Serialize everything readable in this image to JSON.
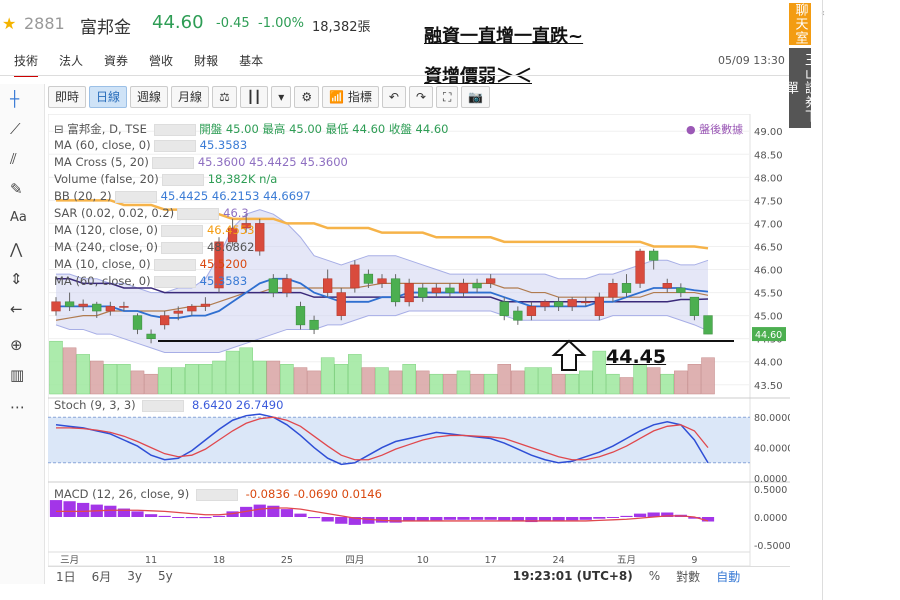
{
  "header": {
    "code": "2881",
    "name": "富邦金",
    "price": "44.60",
    "change": "-0.45",
    "change_pct": "-1.00%",
    "volume": "18,382張"
  },
  "annotation": {
    "line1": "融資一直增一直跌~",
    "line2": "資增價弱＞＜",
    "support_label": "44.45"
  },
  "nav": {
    "tabs": [
      "技術",
      "法人",
      "資券",
      "營收",
      "財報",
      "基本"
    ],
    "datetime": "05/09 13:30"
  },
  "side_tabs": {
    "tab1": "聊天室",
    "tab2": "玉山證券下單"
  },
  "toolbar": {
    "buttons": [
      "即時",
      "日線",
      "週線",
      "月線"
    ],
    "indicator_label": "指標"
  },
  "legend": {
    "symbol": "富邦金, D, TSE",
    "ohlc": "開盤 45.00 最高 45.00 最低 44.60 收盤 44.60",
    "after_hours": "盤後數據",
    "rows": [
      {
        "label": "MA (60, close, 0)",
        "values": "45.3583"
      },
      {
        "label": "MA Cross (5, 20)",
        "values": "45.3600  45.4425  45.3600"
      },
      {
        "label": "Volume (false, 20)",
        "values": "18,382K  n/a"
      },
      {
        "label": "BB (20, 2)",
        "values": "45.4425  46.2153  44.6697"
      },
      {
        "label": "SAR (0.02, 0.02, 0.2)",
        "values": "46.3"
      },
      {
        "label": "MA (120, close, 0)",
        "values": "46.4553"
      },
      {
        "label": "MA (240, close, 0)",
        "values": "48.6862"
      },
      {
        "label": "MA (10, close, 0)",
        "values": "45.5200"
      },
      {
        "label": "MA (60, close, 0)",
        "values": "45.3583"
      }
    ],
    "stoch": {
      "label": "Stoch (9, 3, 3)",
      "values": "8.6420  26.7490"
    },
    "macd": {
      "label": "MACD (12, 26, close, 9)",
      "values": "-0.0836  -0.0690  0.0146"
    }
  },
  "bottom": {
    "ranges": [
      "1日",
      "6月",
      "3y",
      "5y"
    ],
    "time": "19:23:01 (UTC+8)",
    "pct": "%",
    "log": "對數",
    "auto": "自動"
  },
  "chart_data": {
    "type": "candlestick",
    "price_axis_ticks": [
      "49.00",
      "48.50",
      "48.00",
      "47.50",
      "47.00",
      "46.50",
      "46.00",
      "45.50",
      "45.00",
      "44.50",
      "44.00",
      "43.50"
    ],
    "price_tag": "44.60",
    "x_tick_labels": [
      "三月",
      "11",
      "18",
      "25",
      "四月",
      "10",
      "17",
      "24",
      "五月",
      "9"
    ],
    "stoch_ticks": [
      "80.0000",
      "40.0000",
      "0.0000"
    ],
    "macd_ticks": [
      "0.5000",
      "0.0000",
      "-0.5000"
    ],
    "support_level": 44.45,
    "ylim": [
      43.3,
      49.2
    ],
    "candles": [
      {
        "o": 45.1,
        "c": 45.3,
        "h": 45.4,
        "l": 45.0
      },
      {
        "o": 45.3,
        "c": 45.2,
        "h": 45.5,
        "l": 45.1
      },
      {
        "o": 45.2,
        "c": 45.25,
        "h": 45.35,
        "l": 45.1
      },
      {
        "o": 45.25,
        "c": 45.1,
        "h": 45.3,
        "l": 44.95
      },
      {
        "o": 45.1,
        "c": 45.2,
        "h": 45.3,
        "l": 45.0
      },
      {
        "o": 45.2,
        "c": 45.2,
        "h": 45.3,
        "l": 45.1
      },
      {
        "o": 45.0,
        "c": 44.7,
        "h": 45.05,
        "l": 44.6
      },
      {
        "o": 44.6,
        "c": 44.5,
        "h": 44.7,
        "l": 44.4
      },
      {
        "o": 44.8,
        "c": 45.0,
        "h": 45.1,
        "l": 44.7
      },
      {
        "o": 45.05,
        "c": 45.1,
        "h": 45.2,
        "l": 44.9
      },
      {
        "o": 45.1,
        "c": 45.2,
        "h": 45.25,
        "l": 45.0
      },
      {
        "o": 45.2,
        "c": 45.25,
        "h": 45.4,
        "l": 45.1
      },
      {
        "o": 45.6,
        "c": 46.6,
        "h": 46.7,
        "l": 45.5
      },
      {
        "o": 46.6,
        "c": 46.9,
        "h": 47.1,
        "l": 46.5
      },
      {
        "o": 46.9,
        "c": 47.0,
        "h": 47.2,
        "l": 46.8
      },
      {
        "o": 46.4,
        "c": 47.0,
        "h": 47.1,
        "l": 46.3
      },
      {
        "o": 45.8,
        "c": 45.5,
        "h": 45.9,
        "l": 45.4
      },
      {
        "o": 45.5,
        "c": 45.8,
        "h": 45.9,
        "l": 45.4
      },
      {
        "o": 45.2,
        "c": 44.8,
        "h": 45.3,
        "l": 44.7
      },
      {
        "o": 44.9,
        "c": 44.7,
        "h": 45.0,
        "l": 44.6
      },
      {
        "o": 45.5,
        "c": 45.8,
        "h": 46.0,
        "l": 45.4
      },
      {
        "o": 45.0,
        "c": 45.5,
        "h": 45.6,
        "l": 44.9
      },
      {
        "o": 45.6,
        "c": 46.1,
        "h": 46.2,
        "l": 45.5
      },
      {
        "o": 45.9,
        "c": 45.7,
        "h": 46.0,
        "l": 45.6
      },
      {
        "o": 45.7,
        "c": 45.8,
        "h": 45.9,
        "l": 45.6
      },
      {
        "o": 45.8,
        "c": 45.3,
        "h": 45.9,
        "l": 45.2
      },
      {
        "o": 45.3,
        "c": 45.7,
        "h": 45.8,
        "l": 45.2
      },
      {
        "o": 45.6,
        "c": 45.4,
        "h": 45.7,
        "l": 45.3
      },
      {
        "o": 45.5,
        "c": 45.6,
        "h": 45.7,
        "l": 45.4
      },
      {
        "o": 45.6,
        "c": 45.5,
        "h": 45.7,
        "l": 45.4
      },
      {
        "o": 45.5,
        "c": 45.7,
        "h": 45.8,
        "l": 45.4
      },
      {
        "o": 45.7,
        "c": 45.6,
        "h": 45.8,
        "l": 45.5
      },
      {
        "o": 45.7,
        "c": 45.8,
        "h": 45.9,
        "l": 45.6
      },
      {
        "o": 45.3,
        "c": 45.0,
        "h": 45.4,
        "l": 44.9
      },
      {
        "o": 45.1,
        "c": 44.9,
        "h": 45.2,
        "l": 44.8
      },
      {
        "o": 45.0,
        "c": 45.2,
        "h": 45.3,
        "l": 44.9
      },
      {
        "o": 45.2,
        "c": 45.3,
        "h": 45.35,
        "l": 45.1
      },
      {
        "o": 45.3,
        "c": 45.2,
        "h": 45.4,
        "l": 45.1
      },
      {
        "o": 45.2,
        "c": 45.35,
        "h": 45.4,
        "l": 45.1
      },
      {
        "o": 45.3,
        "c": 45.3,
        "h": 45.4,
        "l": 45.2
      },
      {
        "o": 45.0,
        "c": 45.4,
        "h": 45.5,
        "l": 44.9
      },
      {
        "o": 45.4,
        "c": 45.7,
        "h": 45.8,
        "l": 45.3
      },
      {
        "o": 45.7,
        "c": 45.5,
        "h": 45.9,
        "l": 45.4
      },
      {
        "o": 45.7,
        "c": 46.4,
        "h": 46.45,
        "l": 45.6
      },
      {
        "o": 46.4,
        "c": 46.2,
        "h": 46.45,
        "l": 46.0
      },
      {
        "o": 45.6,
        "c": 45.7,
        "h": 45.8,
        "l": 45.5
      },
      {
        "o": 45.6,
        "c": 45.5,
        "h": 45.7,
        "l": 45.4
      },
      {
        "o": 45.4,
        "c": 45.0,
        "h": 45.4,
        "l": 44.9
      },
      {
        "o": 45.0,
        "c": 44.6,
        "h": 45.0,
        "l": 44.6
      }
    ],
    "volume": [
      16,
      14,
      12,
      10,
      9,
      9,
      7,
      6,
      8,
      8,
      9,
      9,
      10,
      13,
      14,
      10,
      10,
      9,
      8,
      7,
      11,
      9,
      12,
      8,
      8,
      7,
      9,
      7,
      6,
      6,
      7,
      6,
      6,
      9,
      7,
      8,
      8,
      6,
      6,
      7,
      13,
      6,
      5,
      9,
      8,
      6,
      7,
      9,
      11
    ],
    "bollinger": {
      "upper": [
        45.9,
        45.9,
        45.8,
        45.8,
        45.7,
        45.7,
        45.6,
        45.5,
        45.5,
        45.6,
        45.6,
        45.8,
        46.3,
        46.9,
        47.2,
        47.3,
        47.2,
        47.0,
        46.7,
        46.3,
        46.2,
        46.1,
        46.2,
        46.3,
        46.3,
        46.3,
        46.2,
        46.1,
        46.0,
        45.9,
        45.9,
        45.9,
        45.9,
        45.9,
        45.9,
        45.9,
        45.9,
        45.8,
        45.8,
        45.8,
        45.9,
        45.9,
        46.0,
        46.1,
        46.2,
        46.2,
        46.1,
        46.1,
        46.2
      ],
      "lower": [
        44.8,
        44.7,
        44.7,
        44.6,
        44.6,
        44.5,
        44.4,
        44.3,
        44.2,
        44.2,
        44.2,
        44.2,
        44.2,
        44.3,
        44.4,
        44.5,
        44.6,
        44.7,
        44.7,
        44.7,
        44.8,
        44.8,
        44.9,
        45.0,
        45.0,
        45.0,
        45.1,
        45.1,
        45.1,
        45.1,
        45.1,
        45.1,
        45.1,
        45.0,
        44.9,
        44.9,
        44.9,
        44.9,
        44.9,
        44.9,
        44.9,
        45.0,
        45.0,
        45.0,
        45.0,
        45.0,
        44.9,
        44.8,
        44.67
      ]
    },
    "ma120": [
      47.5,
      47.5,
      47.5,
      47.5,
      47.5,
      47.4,
      47.4,
      47.4,
      47.3,
      47.3,
      47.3,
      47.2,
      47.2,
      47.1,
      47.1,
      47.1,
      47.1,
      47.0,
      47.0,
      47.0,
      46.9,
      46.9,
      46.9,
      46.9,
      46.8,
      46.8,
      46.8,
      46.8,
      46.7,
      46.7,
      46.7,
      46.7,
      46.7,
      46.6,
      46.6,
      46.6,
      46.6,
      46.6,
      46.6,
      46.6,
      46.6,
      46.6,
      46.6,
      46.6,
      46.5,
      46.5,
      46.5,
      46.5,
      46.46
    ],
    "ma60": [
      45.8,
      45.8,
      45.7,
      45.7,
      45.7,
      45.6,
      45.6,
      45.6,
      45.5,
      45.5,
      45.5,
      45.5,
      45.5,
      45.5,
      45.5,
      45.5,
      45.5,
      45.5,
      45.5,
      45.4,
      45.4,
      45.4,
      45.4,
      45.4,
      45.4,
      45.4,
      45.4,
      45.4,
      45.4,
      45.4,
      45.4,
      45.4,
      45.4,
      45.3,
      45.3,
      45.3,
      45.3,
      45.3,
      45.3,
      45.3,
      45.3,
      45.3,
      45.3,
      45.3,
      45.3,
      45.3,
      45.35,
      45.35,
      45.36
    ],
    "ma20": [
      44.9,
      44.95,
      45.0,
      45.0,
      45.1,
      45.1,
      45.1,
      45.1,
      45.1,
      45.15,
      45.2,
      45.2,
      45.3,
      45.4,
      45.5,
      45.5,
      45.6,
      45.6,
      45.6,
      45.6,
      45.6,
      45.6,
      45.6,
      45.65,
      45.7,
      45.7,
      45.7,
      45.7,
      45.7,
      45.7,
      45.7,
      45.7,
      45.7,
      45.6,
      45.6,
      45.5,
      45.5,
      45.4,
      45.4,
      45.4,
      45.4,
      45.4,
      45.4,
      45.4,
      45.5,
      45.5,
      45.5,
      45.5,
      45.44
    ],
    "ma10": [
      45.2,
      45.2,
      45.2,
      45.2,
      45.2,
      45.1,
      45.1,
      45.0,
      44.95,
      44.95,
      45.0,
      45.0,
      45.1,
      45.3,
      45.5,
      45.7,
      45.8,
      45.8,
      45.7,
      45.5,
      45.4,
      45.3,
      45.3,
      45.3,
      45.4,
      45.4,
      45.5,
      45.5,
      45.5,
      45.5,
      45.5,
      45.5,
      45.5,
      45.4,
      45.3,
      45.2,
      45.2,
      45.2,
      45.2,
      45.2,
      45.3,
      45.3,
      45.4,
      45.5,
      45.6,
      45.6,
      45.6,
      45.55,
      45.52
    ],
    "stoch_k": [
      70,
      68,
      66,
      62,
      58,
      50,
      42,
      30,
      24,
      26,
      36,
      50,
      64,
      76,
      82,
      84,
      80,
      70,
      56,
      40,
      26,
      18,
      20,
      30,
      40,
      48,
      52,
      56,
      60,
      58,
      56,
      54,
      52,
      46,
      38,
      30,
      24,
      20,
      22,
      28,
      34,
      42,
      52,
      62,
      70,
      74,
      70,
      50,
      20
    ],
    "stoch_d": [
      66,
      66,
      65,
      63,
      60,
      55,
      48,
      40,
      32,
      28,
      30,
      38,
      50,
      62,
      72,
      78,
      80,
      76,
      68,
      55,
      42,
      30,
      24,
      24,
      30,
      38,
      44,
      50,
      54,
      56,
      56,
      55,
      54,
      52,
      46,
      40,
      34,
      28,
      24,
      24,
      28,
      34,
      42,
      52,
      62,
      68,
      70,
      62,
      40
    ],
    "macd_hist": [
      0.3,
      0.28,
      0.25,
      0.22,
      0.2,
      0.15,
      0.1,
      0.05,
      0.02,
      0.0,
      -0.02,
      -0.02,
      0.02,
      0.1,
      0.18,
      0.22,
      0.2,
      0.14,
      0.06,
      -0.02,
      -0.08,
      -0.12,
      -0.14,
      -0.12,
      -0.1,
      -0.1,
      -0.08,
      -0.08,
      -0.06,
      -0.05,
      -0.05,
      -0.05,
      -0.05,
      -0.06,
      -0.08,
      -0.09,
      -0.08,
      -0.07,
      -0.06,
      -0.05,
      -0.03,
      -0.01,
      0.02,
      0.06,
      0.08,
      0.08,
      0.04,
      -0.03,
      -0.08
    ],
    "macd_line": [
      0.1,
      0.1,
      0.1,
      0.11,
      0.12,
      0.12,
      0.12,
      0.11,
      0.1,
      0.08,
      0.06,
      0.04,
      0.04,
      0.06,
      0.1,
      0.14,
      0.16,
      0.16,
      0.14,
      0.1,
      0.06,
      0.02,
      -0.02,
      -0.04,
      -0.06,
      -0.07,
      -0.07,
      -0.07,
      -0.07,
      -0.07,
      -0.07,
      -0.07,
      -0.07,
      -0.07,
      -0.07,
      -0.07,
      -0.07,
      -0.07,
      -0.07,
      -0.07,
      -0.06,
      -0.05,
      -0.04,
      -0.02,
      0.0,
      0.02,
      0.02,
      0.0,
      -0.07
    ]
  }
}
